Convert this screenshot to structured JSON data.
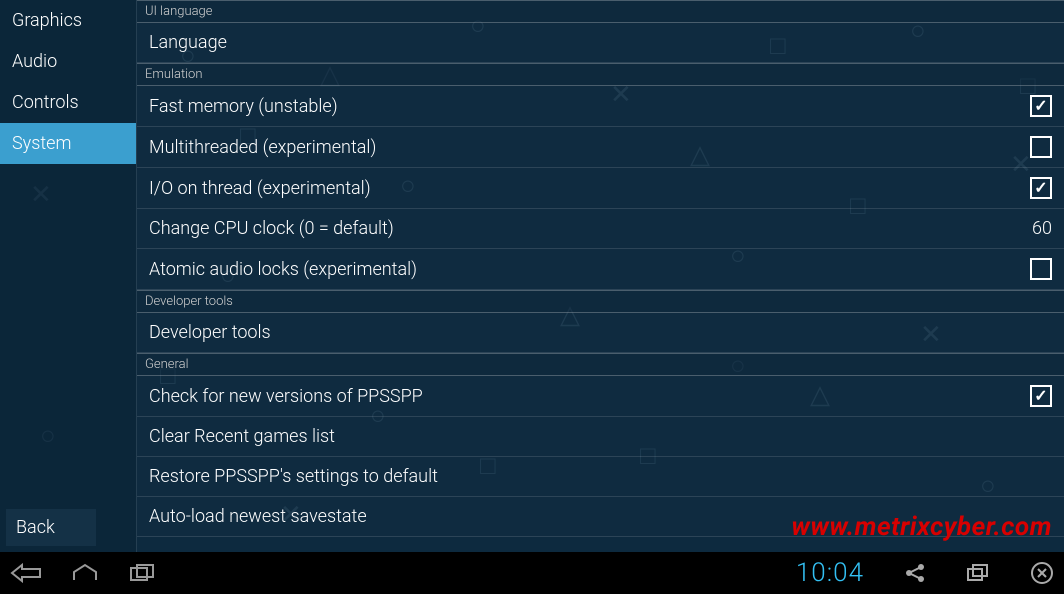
{
  "sidebar": {
    "items": [
      {
        "label": "Graphics",
        "active": false
      },
      {
        "label": "Audio",
        "active": false
      },
      {
        "label": "Controls",
        "active": false
      },
      {
        "label": "System",
        "active": true
      }
    ],
    "back_label": "Back"
  },
  "sections": {
    "ui_language_header": "UI language",
    "language_row": "Language",
    "emulation_header": "Emulation",
    "emulation_rows": [
      {
        "label": "Fast memory (unstable)",
        "type": "check",
        "checked": true
      },
      {
        "label": "Multithreaded (experimental)",
        "type": "check",
        "checked": false
      },
      {
        "label": "I/O on thread (experimental)",
        "type": "check",
        "checked": true
      },
      {
        "label": "Change CPU clock (0 = default)",
        "type": "value",
        "value": "60"
      },
      {
        "label": "Atomic audio locks (experimental)",
        "type": "check",
        "checked": false
      }
    ],
    "dev_tools_header": "Developer tools",
    "dev_tools_row": "Developer tools",
    "general_header": "General",
    "general_rows": [
      {
        "label": "Check for new versions of PPSSPP",
        "type": "check",
        "checked": true
      },
      {
        "label": "Clear Recent games list",
        "type": "action"
      },
      {
        "label": "Restore PPSSPP's settings to default",
        "type": "action"
      },
      {
        "label": "Auto-load newest savestate",
        "type": "action"
      }
    ]
  },
  "watermark": "www.metrixcyber.com",
  "navbar": {
    "clock": "10:04"
  }
}
